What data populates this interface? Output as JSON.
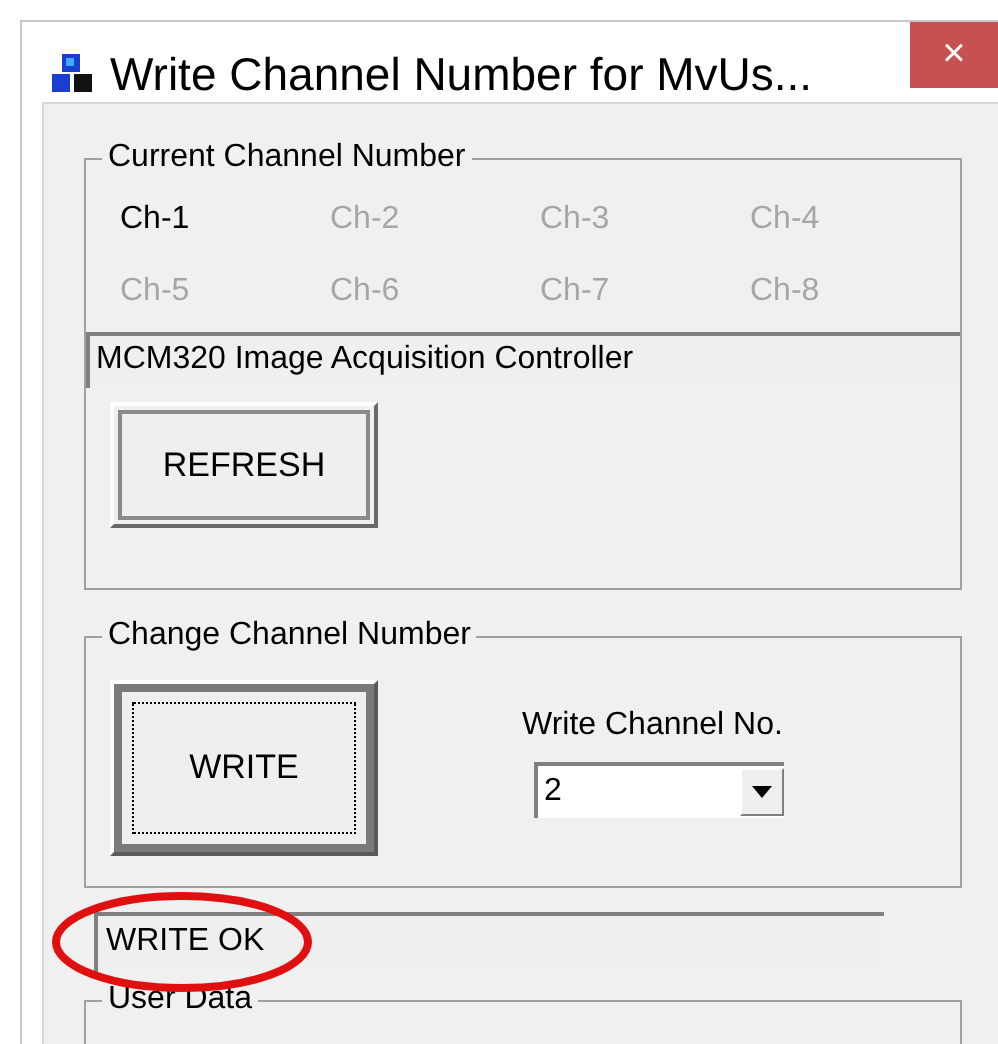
{
  "window": {
    "title": "Write Channel Number for MvUs...",
    "close": "×"
  },
  "current_channel": {
    "label": "Current Channel Number",
    "channels": [
      {
        "label": "Ch-1",
        "active": true
      },
      {
        "label": "Ch-2",
        "active": false
      },
      {
        "label": "Ch-3",
        "active": false
      },
      {
        "label": "Ch-4",
        "active": false
      },
      {
        "label": "Ch-5",
        "active": false
      },
      {
        "label": "Ch-6",
        "active": false
      },
      {
        "label": "Ch-7",
        "active": false
      },
      {
        "label": "Ch-8",
        "active": false
      }
    ],
    "device": "MCM320 Image Acquisition Controller",
    "refresh_button": "REFRESH"
  },
  "change_channel": {
    "label": "Change Channel Number",
    "write_button": "WRITE",
    "write_label": "Write Channel No.",
    "channel_select": {
      "value": "2"
    }
  },
  "status": {
    "text": "WRITE OK",
    "highlighted": true
  },
  "user_data": {
    "label": "User Data"
  }
}
